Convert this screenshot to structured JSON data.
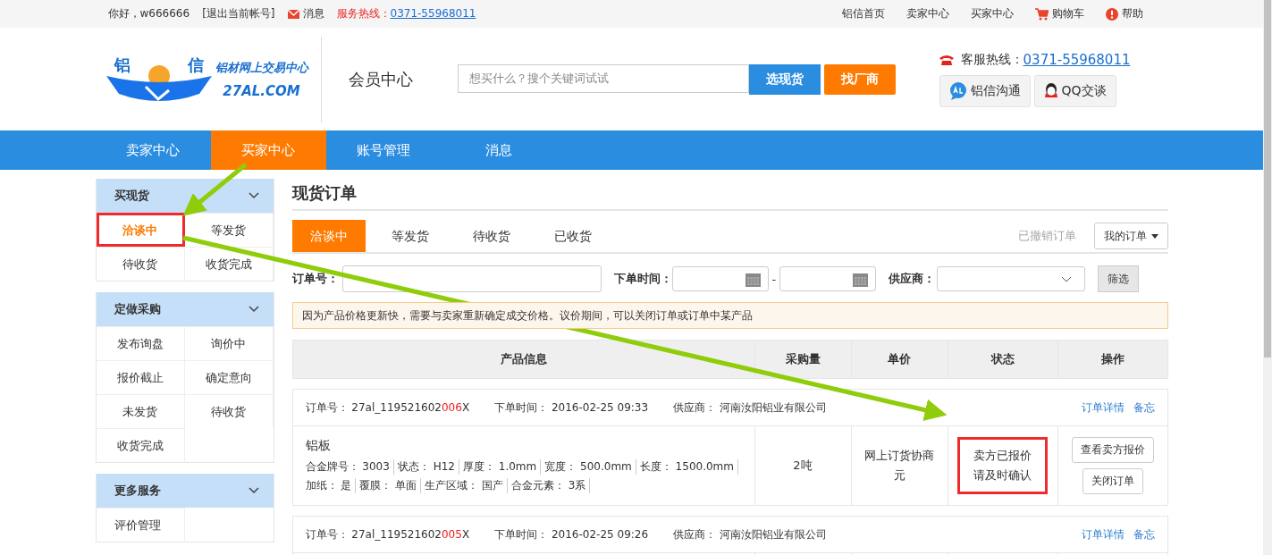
{
  "topbar": {
    "greeting": "你好，w666666",
    "logout": "[退出当前帐号]",
    "messages": "消息",
    "hotline_label": "服务热线：",
    "hotline_number": "0371-55968011",
    "links": [
      {
        "kind": "plain",
        "label": "铝信首页"
      },
      {
        "kind": "plain",
        "label": "卖家中心"
      },
      {
        "kind": "plain",
        "label": "买家中心"
      },
      {
        "kind": "cart",
        "label": "购物车"
      },
      {
        "kind": "help",
        "label": "帮助"
      }
    ]
  },
  "header": {
    "logo_chars": [
      "铝",
      "信"
    ],
    "logo_slogan": "铝材网上交易中心",
    "logo_domain": "27AL.COM",
    "section_title": "会员中心",
    "search": {
      "placeholder": "想买什么？搜个关键词试试"
    },
    "search_buttons": [
      {
        "kind": "primary",
        "label": "选现货"
      },
      {
        "kind": "accent",
        "label": "找厂商"
      }
    ],
    "service_label": "客服热线：",
    "service_number": "0371-55968011",
    "chat_buttons": [
      {
        "kind": "al",
        "label": "铝信沟通"
      },
      {
        "kind": "qq",
        "label": "QQ交谈"
      }
    ]
  },
  "nav": [
    {
      "label": "卖家中心",
      "selected": false
    },
    {
      "label": "买家中心",
      "selected": true
    },
    {
      "label": "账号管理",
      "selected": false
    },
    {
      "label": "消息",
      "selected": false
    }
  ],
  "sidebar": [
    {
      "title": "买现货",
      "items": [
        {
          "label": "洽谈中",
          "selected": true,
          "highlighted": true
        },
        {
          "label": "等发货",
          "selected": false,
          "highlighted": false
        },
        {
          "label": "待收货",
          "selected": false,
          "highlighted": false
        },
        {
          "label": "收货完成",
          "selected": false,
          "highlighted": false
        }
      ]
    },
    {
      "title": "定做采购",
      "items": [
        {
          "label": "发布询盘",
          "selected": false,
          "highlighted": false
        },
        {
          "label": "询价中",
          "selected": false,
          "highlighted": false
        },
        {
          "label": "报价截止",
          "selected": false,
          "highlighted": false
        },
        {
          "label": "确定意向",
          "selected": false,
          "highlighted": false
        },
        {
          "label": "未发货",
          "selected": false,
          "highlighted": false
        },
        {
          "label": "待收货",
          "selected": false,
          "highlighted": false
        },
        {
          "label": "收货完成",
          "selected": false,
          "highlighted": false
        }
      ]
    },
    {
      "title": "更多服务",
      "items": [
        {
          "label": "评价管理",
          "selected": false,
          "highlighted": false
        }
      ]
    }
  ],
  "main": {
    "title": "现货订单",
    "tabs": [
      {
        "label": "洽谈中",
        "selected": true
      },
      {
        "label": "等发货",
        "selected": false
      },
      {
        "label": "待收货",
        "selected": false
      },
      {
        "label": "已收货",
        "selected": false
      }
    ],
    "cancelled_link": "已撤销订单",
    "my_orders": "我的订单",
    "filters": {
      "order_no_label": "订单号：",
      "time_label": "下单时间：",
      "range_separator": "-",
      "supplier_label": "供应商：",
      "filter_button": "筛选"
    },
    "notice": "因为产品价格更新快，需要与卖家重新确定成交价格。议价期间，可以关闭订单或订单中某产品",
    "columns": [
      "产品信息",
      "采购量",
      "单价",
      "状态",
      "操作"
    ],
    "orders": [
      {
        "order_no_label": "订单号：",
        "order_no_prefix": "27al_119521602",
        "order_no_highlight": "006",
        "order_no_suffix": "X",
        "time_label": "下单时间：",
        "time": "2016-02-25 09:33",
        "supplier_label": "供应商：",
        "supplier": "河南汝阳铝业有限公司",
        "links": [
          "订单详情",
          "备忘"
        ],
        "product": {
          "name": "铝板",
          "specs": [
            [
              "合金牌号： 3003",
              "状态： H12",
              "厚度： 1.0mm",
              "宽度： 500.0mm",
              "长度： 1500.0mm"
            ],
            [
              "加纸： 是",
              "覆膜： 单面",
              "生产区域： 国产",
              "合金元素： 3系"
            ]
          ]
        },
        "quantity": "2吨",
        "price": "网上订货协商元",
        "status": [
          "卖方已报价",
          "请及时确认"
        ],
        "status_highlighted": true,
        "actions": [
          "查看卖方报价",
          "关闭订单"
        ]
      },
      {
        "order_no_label": "订单号：",
        "order_no_prefix": "27al_119521602",
        "order_no_highlight": "005",
        "order_no_suffix": "X",
        "time_label": "下单时间：",
        "time": "2016-02-25 09:26",
        "supplier_label": "供应商：",
        "supplier": "河南汝阳铝业有限公司",
        "links": [
          "订单详情",
          "备忘"
        ]
      }
    ]
  }
}
